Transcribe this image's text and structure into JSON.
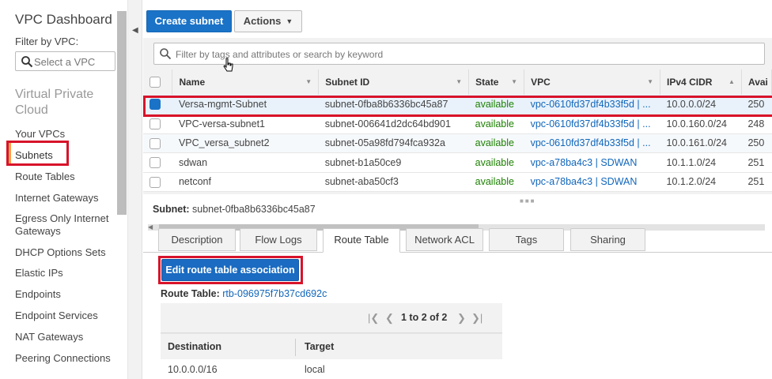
{
  "sidebar": {
    "title": "VPC Dashboard",
    "filter_label": "Filter by VPC:",
    "select_placeholder": "Select a VPC",
    "section": "Virtual Private Cloud",
    "items": [
      "Your VPCs",
      "Subnets",
      "Route Tables",
      "Internet Gateways",
      "Egress Only Internet Gateways",
      "DHCP Options Sets",
      "Elastic IPs",
      "Endpoints",
      "Endpoint Services",
      "NAT Gateways",
      "Peering Connections"
    ],
    "active_item": "Subnets"
  },
  "toolbar": {
    "create_label": "Create subnet",
    "actions_label": "Actions"
  },
  "search": {
    "placeholder": "Filter by tags and attributes or search by keyword"
  },
  "grid": {
    "columns": [
      "Name",
      "Subnet ID",
      "State",
      "VPC",
      "IPv4 CIDR",
      "Avai"
    ],
    "rows": [
      {
        "name": "Versa-mgmt-Subnet",
        "subnet_id": "subnet-0fba8b6336bc45a87",
        "state": "available",
        "vpc": "vpc-0610fd37df4b33f5d | ...",
        "cidr": "10.0.0.0/24",
        "avail": "250",
        "selected": true
      },
      {
        "name": "VPC-versa-subnet1",
        "subnet_id": "subnet-006641d2dc64bd901",
        "state": "available",
        "vpc": "vpc-0610fd37df4b33f5d | ...",
        "cidr": "10.0.160.0/24",
        "avail": "248",
        "selected": false
      },
      {
        "name": "VPC_versa_subnet2",
        "subnet_id": "subnet-05a98fd794fca932a",
        "state": "available",
        "vpc": "vpc-0610fd37df4b33f5d | ...",
        "cidr": "10.0.161.0/24",
        "avail": "250",
        "selected": false
      },
      {
        "name": "sdwan",
        "subnet_id": "subnet-b1a50ce9",
        "state": "available",
        "vpc": "vpc-a78ba4c3 | SDWAN",
        "cidr": "10.1.1.0/24",
        "avail": "251",
        "selected": false
      },
      {
        "name": "netconf",
        "subnet_id": "subnet-aba50cf3",
        "state": "available",
        "vpc": "vpc-a78ba4c3 | SDWAN",
        "cidr": "10.1.2.0/24",
        "avail": "251",
        "selected": false
      }
    ]
  },
  "detail": {
    "subnet_label": "Subnet:",
    "subnet_value": "subnet-0fba8b6336bc45a87",
    "tabs": [
      "Description",
      "Flow Logs",
      "Route Table",
      "Network ACL",
      "Tags",
      "Sharing"
    ],
    "active_tab": "Route Table",
    "edit_button": "Edit route table association",
    "route_table_label": "Route Table:",
    "route_table_value": "rtb-096975f7b37cd692c",
    "pager_text": "1 to 2 of 2",
    "route_columns": [
      "Destination",
      "Target"
    ],
    "routes": [
      {
        "destination": "10.0.0.0/16",
        "target": "local"
      }
    ]
  }
}
